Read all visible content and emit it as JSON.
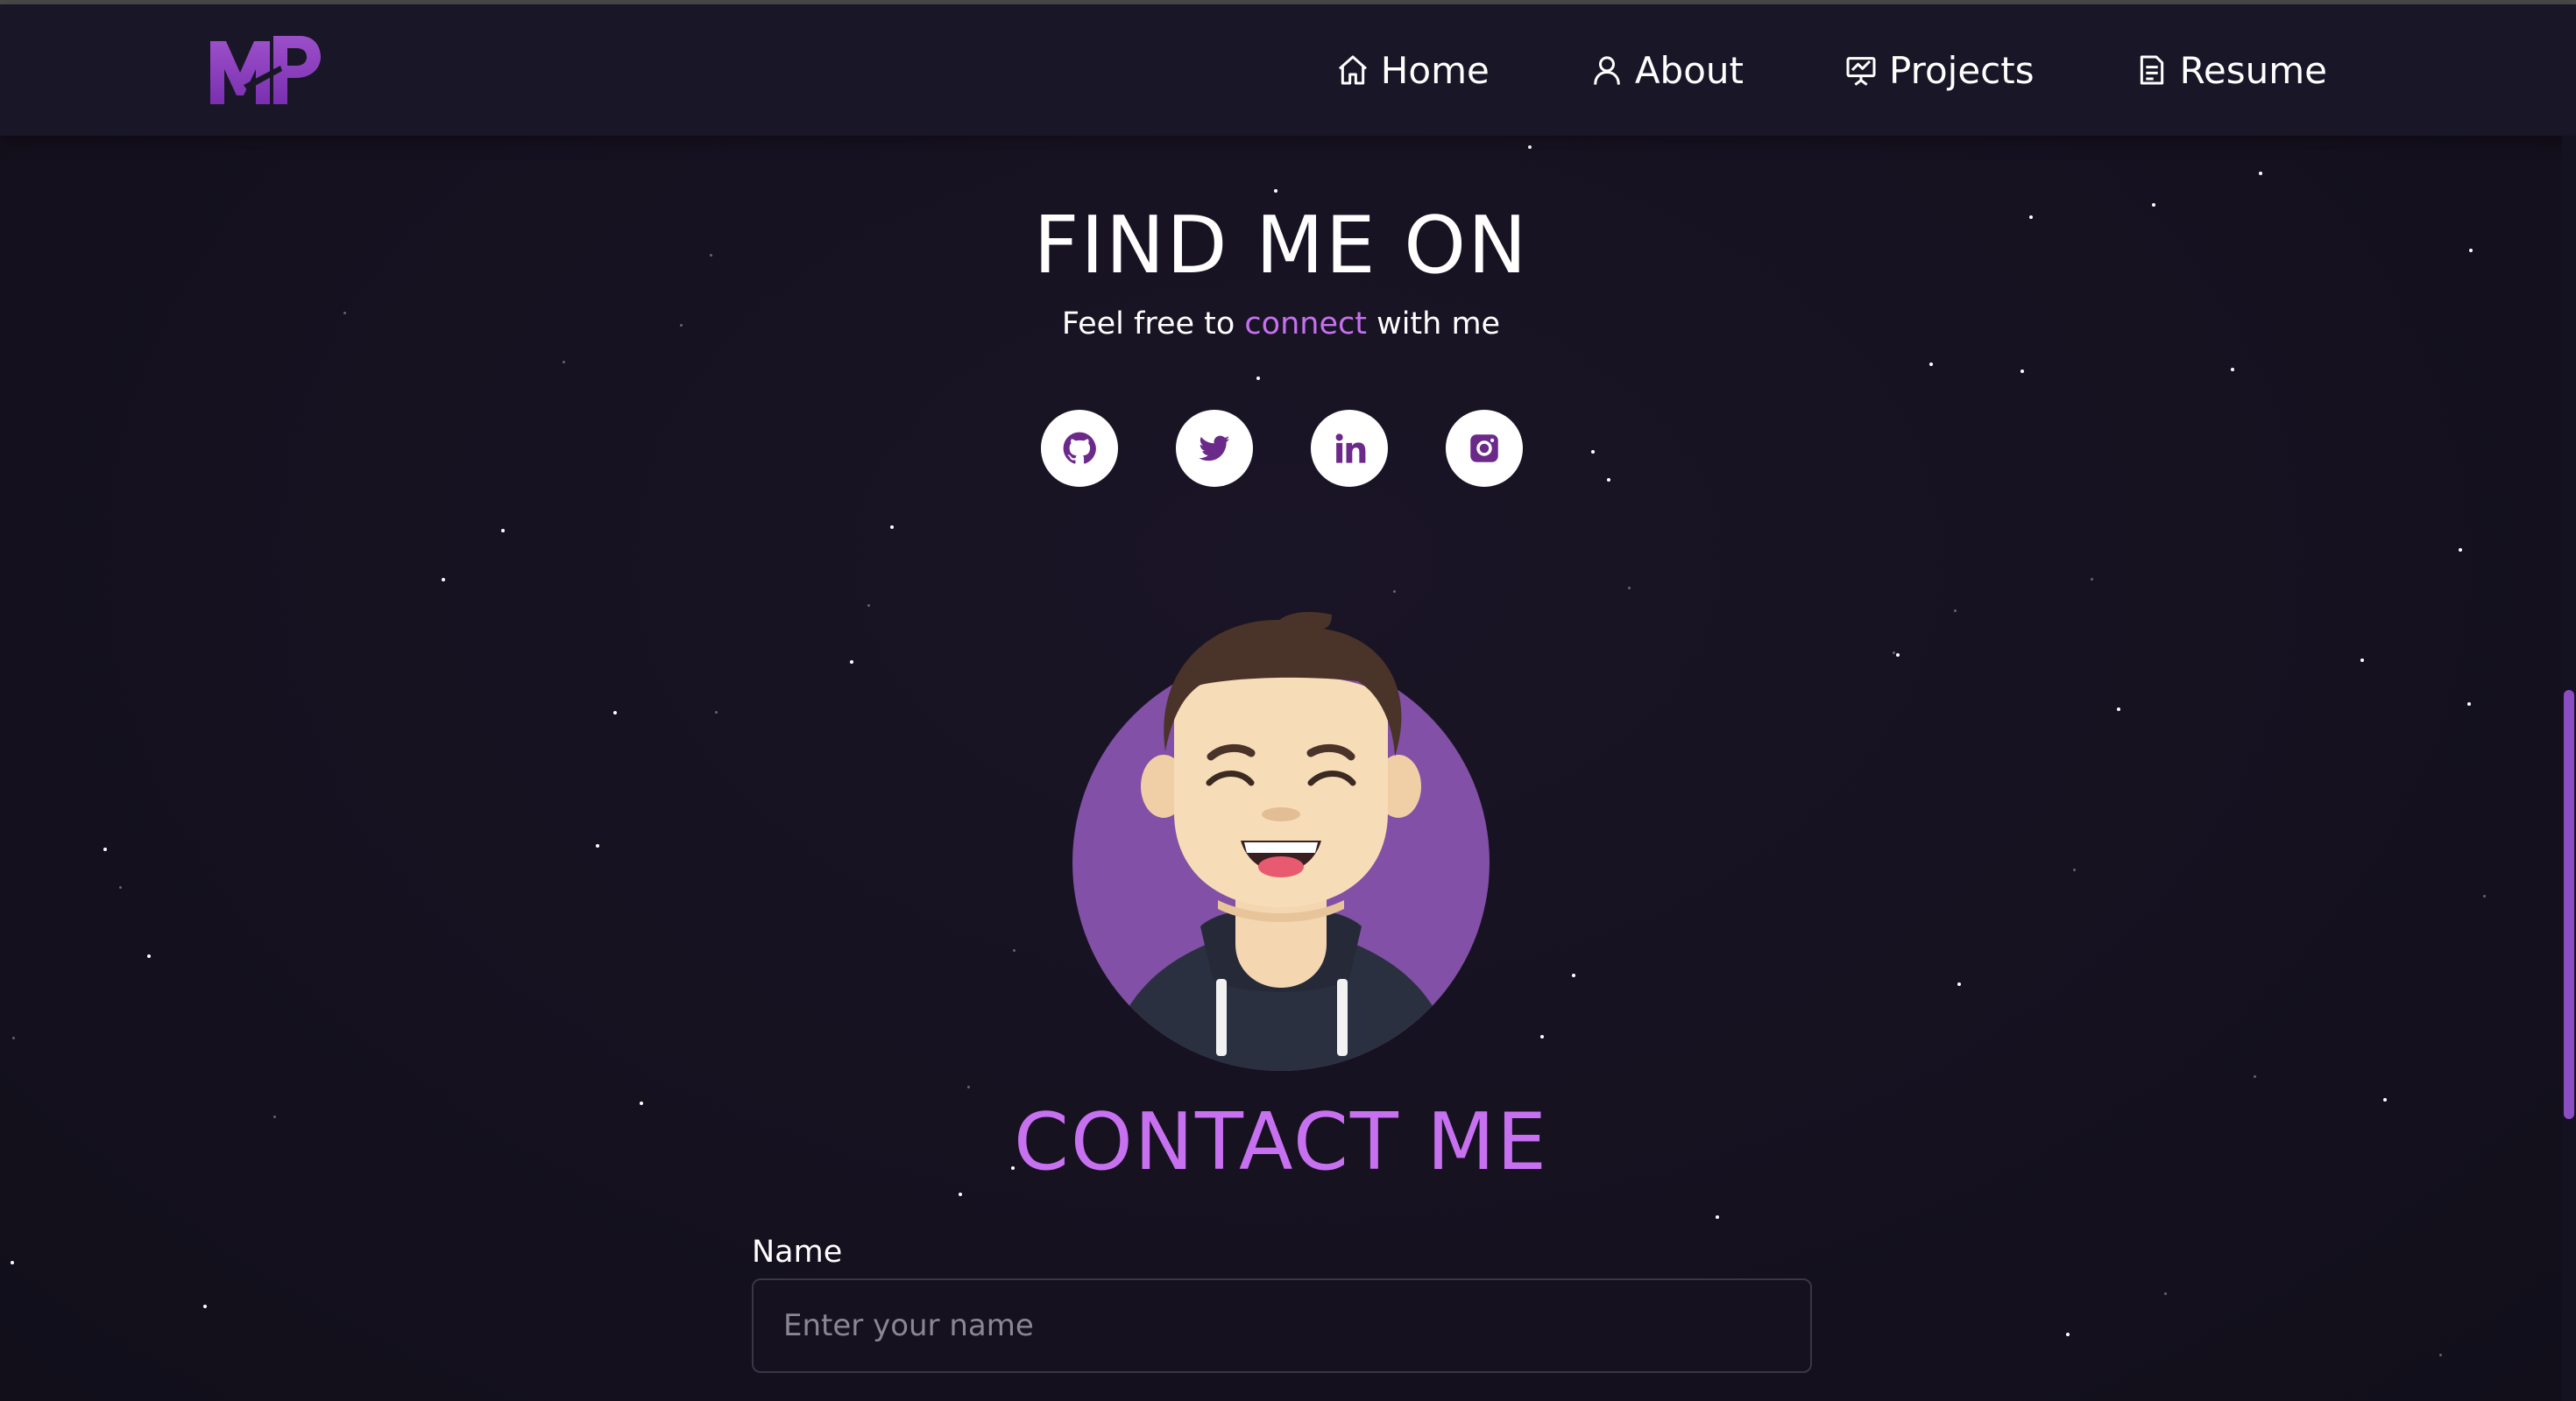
{
  "nav": {
    "logo_text": "MP",
    "items": [
      {
        "label": "Home",
        "icon": "home-icon"
      },
      {
        "label": "About",
        "icon": "user-icon"
      },
      {
        "label": "Projects",
        "icon": "presentation-icon"
      },
      {
        "label": "Resume",
        "icon": "document-icon"
      }
    ]
  },
  "find": {
    "title": "FIND ME ON",
    "subtitle_before": "Feel free to ",
    "subtitle_accent": "connect",
    "subtitle_after": " with me",
    "socials": [
      {
        "icon": "github-icon"
      },
      {
        "icon": "twitter-icon"
      },
      {
        "icon": "linkedin-icon"
      },
      {
        "icon": "instagram-icon"
      }
    ]
  },
  "contact": {
    "title": "CONTACT ME",
    "name_label": "Name",
    "name_placeholder": "Enter your name",
    "name_value": ""
  },
  "colors": {
    "accent": "#c770f0",
    "background": "#15111f",
    "navbar": "#191727",
    "avatar_circle": "#8250a6",
    "social_icon": "#6b2a8a"
  }
}
